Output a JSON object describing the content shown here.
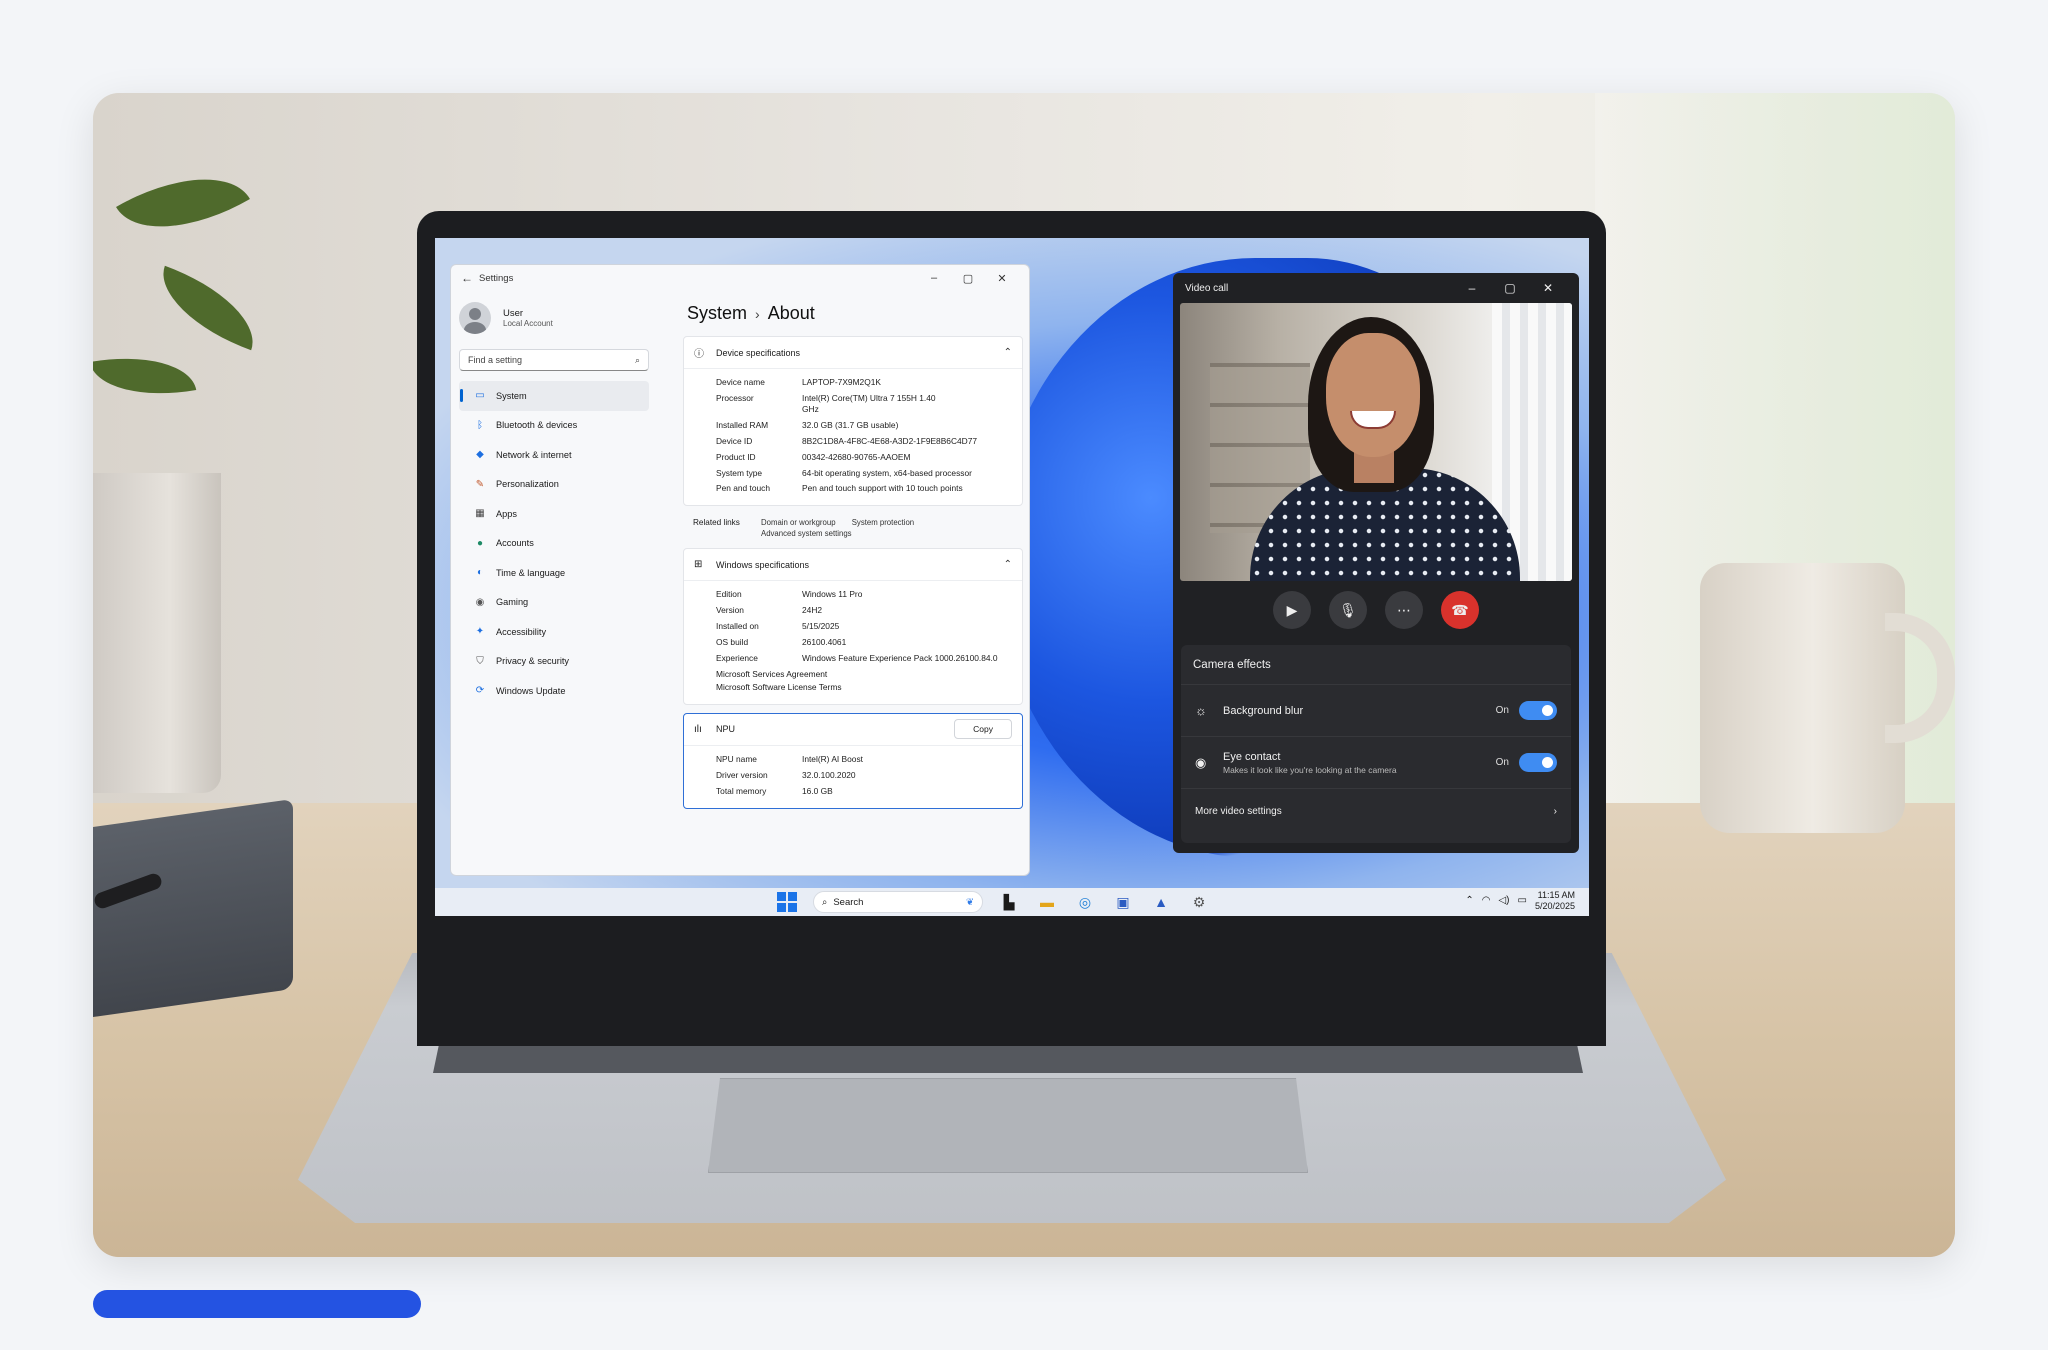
{
  "settings": {
    "window_title": "Settings",
    "user": {
      "name": "User",
      "account": "Local Account"
    },
    "search_placeholder": "Find a setting",
    "nav": [
      {
        "label": "System",
        "icon": "system-icon"
      },
      {
        "label": "Bluetooth & devices",
        "icon": "bluetooth-icon"
      },
      {
        "label": "Network & internet",
        "icon": "wifi-icon"
      },
      {
        "label": "Personalization",
        "icon": "brush-icon"
      },
      {
        "label": "Apps",
        "icon": "apps-icon"
      },
      {
        "label": "Accounts",
        "icon": "person-icon"
      },
      {
        "label": "Time & language",
        "icon": "globe-icon"
      },
      {
        "label": "Gaming",
        "icon": "gamepad-icon"
      },
      {
        "label": "Accessibility",
        "icon": "accessibility-icon"
      },
      {
        "label": "Privacy & security",
        "icon": "shield-icon"
      },
      {
        "label": "Windows Update",
        "icon": "update-icon"
      }
    ],
    "breadcrumb": {
      "parent": "System",
      "separator": "›",
      "current": "About"
    },
    "device_specs": {
      "title": "Device specifications",
      "rows": [
        {
          "k": "Device name",
          "v": "LAPTOP-7X9M2Q1K"
        },
        {
          "k": "Processor",
          "v": "Intel(R) Core(TM) Ultra 7 155H 1.40 GHz"
        },
        {
          "k": "Installed RAM",
          "v": "32.0 GB (31.7 GB usable)"
        },
        {
          "k": "Device ID",
          "v": "8B2C1D8A-4F8C-4E68-A3D2-1F9E8B6C4D77"
        },
        {
          "k": "Product ID",
          "v": "00342-42680-90765-AAOEM"
        },
        {
          "k": "System type",
          "v": "64-bit operating system, x64-based processor"
        },
        {
          "k": "Pen and touch",
          "v": "Pen and touch support with 10 touch points"
        }
      ]
    },
    "related_links": {
      "label": "Related links",
      "links": [
        "Domain or workgroup",
        "System protection"
      ],
      "extra": "Advanced system settings"
    },
    "windows_specs": {
      "title": "Windows specifications",
      "rows": [
        {
          "k": "Edition",
          "v": "Windows 11 Pro"
        },
        {
          "k": "Version",
          "v": "24H2"
        },
        {
          "k": "Installed on",
          "v": "5/15/2025"
        },
        {
          "k": "OS build",
          "v": "26100.4061"
        },
        {
          "k": "Experience",
          "v": "Windows Feature Experience Pack 1000.26100.84.0"
        }
      ],
      "links": [
        "Microsoft Services Agreement",
        "Microsoft Software License Terms"
      ]
    },
    "npu": {
      "title": "NPU",
      "copy_label": "Copy",
      "rows": [
        {
          "k": "NPU name",
          "v": "Intel(R) AI Boost"
        },
        {
          "k": "Driver version",
          "v": "32.0.100.2020"
        },
        {
          "k": "Total memory",
          "v": "16.0 GB"
        }
      ]
    }
  },
  "video_call": {
    "window_title": "Video call",
    "effects_title": "Camera effects",
    "background_blur": {
      "label": "Background blur",
      "state": "On"
    },
    "eye_contact": {
      "label": "Eye contact",
      "sub": "Makes it look like you're looking at the camera",
      "state": "On"
    },
    "more_settings": "More video settings"
  },
  "taskbar": {
    "search_label": "Search",
    "time": "11:15 AM",
    "date": "5/20/2025"
  },
  "colors": {
    "accent": "#2453e2",
    "end_call": "#d9322c",
    "toggle_on": "#3f8cf2"
  }
}
